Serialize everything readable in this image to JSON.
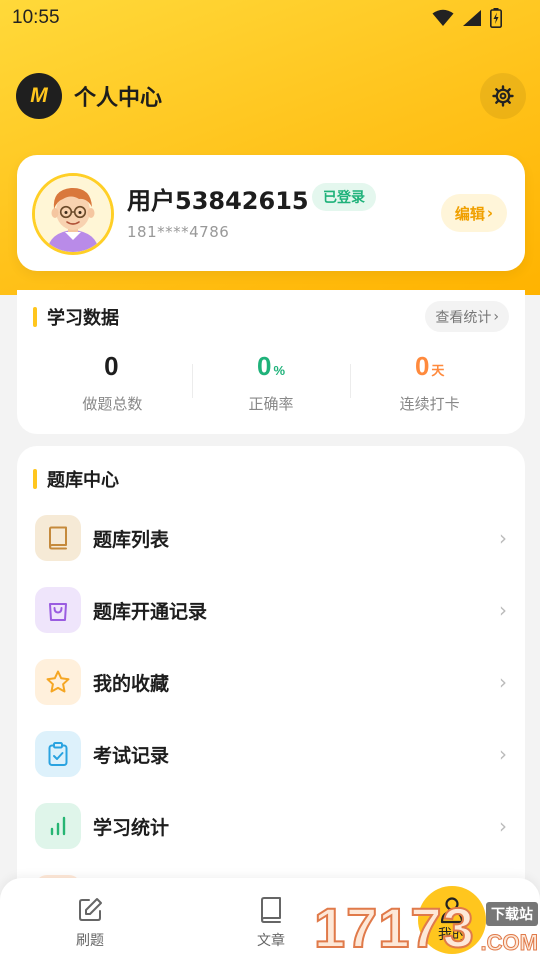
{
  "status_bar": {
    "time": "10:55"
  },
  "header": {
    "logo_text": "M",
    "title": "个人中心"
  },
  "profile": {
    "username": "用户53842615",
    "login_badge": "已登录",
    "phone": "181****4786",
    "edit_label": "编辑",
    "edit_arrow": "›"
  },
  "study_data": {
    "title": "学习数据",
    "view_stats_label": "查看统计",
    "view_stats_arrow": "›",
    "stats": [
      {
        "value": "0",
        "unit": "",
        "label": "做题总数",
        "color": "#1d1d1d"
      },
      {
        "value": "0",
        "unit": "%",
        "label": "正确率",
        "color": "#1fb27a"
      },
      {
        "value": "0",
        "unit": "天",
        "label": "连续打卡",
        "color": "#ff8a3d"
      }
    ]
  },
  "question_bank": {
    "title": "题库中心",
    "items": [
      {
        "label": "题库列表",
        "icon": "book-icon",
        "bg": "#f6ead6",
        "color": "#c58a3c",
        "arrow": "›"
      },
      {
        "label": "题库开通记录",
        "icon": "shopping-bag-icon",
        "bg": "#efe5fb",
        "color": "#9a5ce0",
        "arrow": "›"
      },
      {
        "label": "我的收藏",
        "icon": "star-icon",
        "bg": "#fff0dc",
        "color": "#f5a623",
        "arrow": "›"
      },
      {
        "label": "考试记录",
        "icon": "clipboard-check-icon",
        "bg": "#ddf1fb",
        "color": "#2aa3e0",
        "arrow": "›"
      },
      {
        "label": "学习统计",
        "icon": "bar-chart-icon",
        "bg": "#dff5ea",
        "color": "#26b573",
        "arrow": "›"
      }
    ]
  },
  "tab_bar": {
    "tabs": [
      {
        "label": "刷题",
        "icon": "edit-icon"
      },
      {
        "label": "文章",
        "icon": "book-icon"
      },
      {
        "label": "我的",
        "icon": "user-icon",
        "active": true
      }
    ]
  },
  "watermark": {
    "digits": "17173",
    "badge": "下载站",
    "domain": ".COM"
  },
  "colors": {
    "accent": "#ffc61e",
    "background": "#f3f3f3"
  }
}
